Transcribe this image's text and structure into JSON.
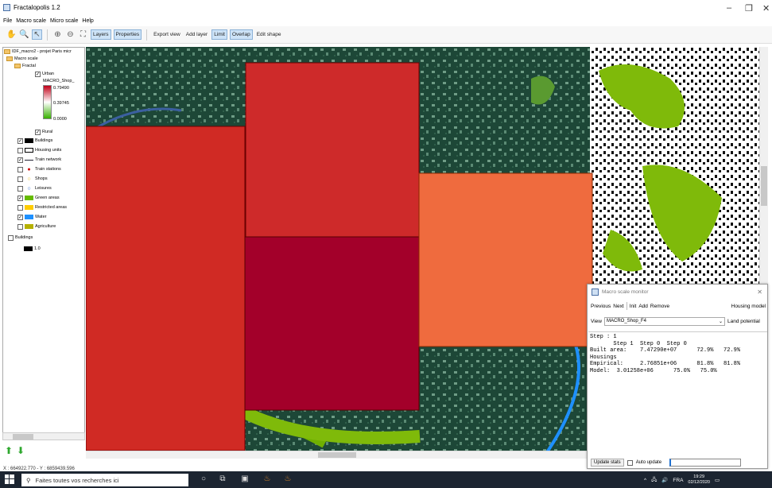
{
  "window": {
    "title": "Fractalopolis 1.2",
    "minimize_icon": "–",
    "maximize_icon": "❐",
    "close_icon": "✕"
  },
  "menu": [
    "File",
    "Macro scale",
    "Micro scale",
    "Help"
  ],
  "toolbar": {
    "layers_label": "Layers",
    "properties_label": "Properties",
    "export_view_label": "Export view",
    "add_layer_label": "Add layer",
    "limit_label": "Limit",
    "overlap_label": "Overlap",
    "edit_shape_label": "Edit shape"
  },
  "tree": {
    "root": "IDF_macro2 - projet Paris micr",
    "macro_scale": "Macro scale",
    "fractal": "Fractal",
    "urban": "Urban",
    "shop_attr": "MACRO_Shop_",
    "legend_max": "0.79490",
    "legend_mid": "0.39745",
    "legend_min": "0.0000",
    "rural": "Rural",
    "layers": [
      {
        "label": "Buildings",
        "checked": true,
        "swatch": "#000000"
      },
      {
        "label": "Housing units",
        "checked": false,
        "swatch": "#ffffff"
      },
      {
        "label": "Train network",
        "checked": true,
        "swatch": "line"
      },
      {
        "label": "Train stations",
        "checked": false,
        "swatch": "dot-red"
      },
      {
        "label": "Shops",
        "checked": false,
        "swatch": "dot-yellow"
      },
      {
        "label": "Leisures",
        "checked": false,
        "swatch": "dot-blue"
      },
      {
        "label": "Green areas",
        "checked": true,
        "swatch": "#66bb00"
      },
      {
        "label": "Restricted areas",
        "checked": false,
        "swatch": "#ffcc00"
      },
      {
        "label": "Water",
        "checked": true,
        "swatch": "#1e90ff"
      },
      {
        "label": "Agriculture",
        "checked": false,
        "swatch": "#b5b000"
      }
    ],
    "micro_buildings": "Buildings",
    "micro_value": "1.0"
  },
  "status": {
    "coords": "X : 664922.770 - Y : 6859439.596"
  },
  "map": {
    "cells": [
      {
        "name": "map-cell-top-center",
        "color": "#ce2a2a"
      },
      {
        "name": "map-cell-left",
        "color": "#d02a24"
      },
      {
        "name": "map-cell-center",
        "color": "#a3002a"
      },
      {
        "name": "map-cell-right",
        "color": "#ef6b3e"
      }
    ]
  },
  "monitor": {
    "title": "Macro scale monitor",
    "close_icon": "✕",
    "buttons": [
      "Previous",
      "Next",
      "Init",
      "Add",
      "Remove"
    ],
    "housing_model": "Housing model",
    "view_label": "View",
    "view_value": "MACRO_Shop_F4",
    "land_potential": "Land potential",
    "output": "Step : 1\n       Step 1  Step 0  Step 0\nBuilt area:    7.47290e+07      72.9%   72.9%\nHousings\nEmpirical:     2.76851e+06      81.8%   81.8%\nModel:  3.01258e+06      75.0%   75.0%",
    "update_stats": "Update stats",
    "auto_update": "Auto update"
  },
  "taskbar": {
    "search_placeholder": "Faites toutes vos recherches ici",
    "lang": "FRA",
    "time": "19:29",
    "date": "02/12/2020"
  }
}
